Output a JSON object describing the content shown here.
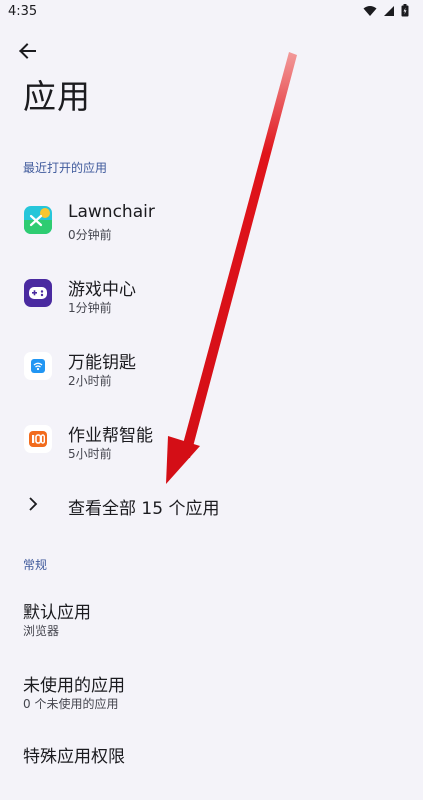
{
  "status": {
    "time": "4:35"
  },
  "page": {
    "title": "应用"
  },
  "recent": {
    "header": "最近打开的应用",
    "apps": [
      {
        "name": "Lawnchair",
        "time": "0分钟前"
      },
      {
        "name": "游戏中心",
        "time": "1分钟前"
      },
      {
        "name": "万能钥匙",
        "time": "2小时前"
      },
      {
        "name": "作业帮智能",
        "time": "5小时前"
      }
    ],
    "view_all": "查看全部 15 个应用"
  },
  "general": {
    "header": "常规",
    "items": [
      {
        "title": "默认应用",
        "subtitle": "浏览器"
      },
      {
        "title": "未使用的应用",
        "subtitle": "0 个未使用的应用"
      },
      {
        "title": "特殊应用权限"
      }
    ]
  },
  "colors": {
    "accent": "#3f5a9c",
    "background": "#f4f3f9",
    "annotation_arrow": "#e0141b"
  },
  "icons": [
    "wifi-icon",
    "signal-icon",
    "battery-icon",
    "back-arrow-icon",
    "chevron-right-icon"
  ]
}
